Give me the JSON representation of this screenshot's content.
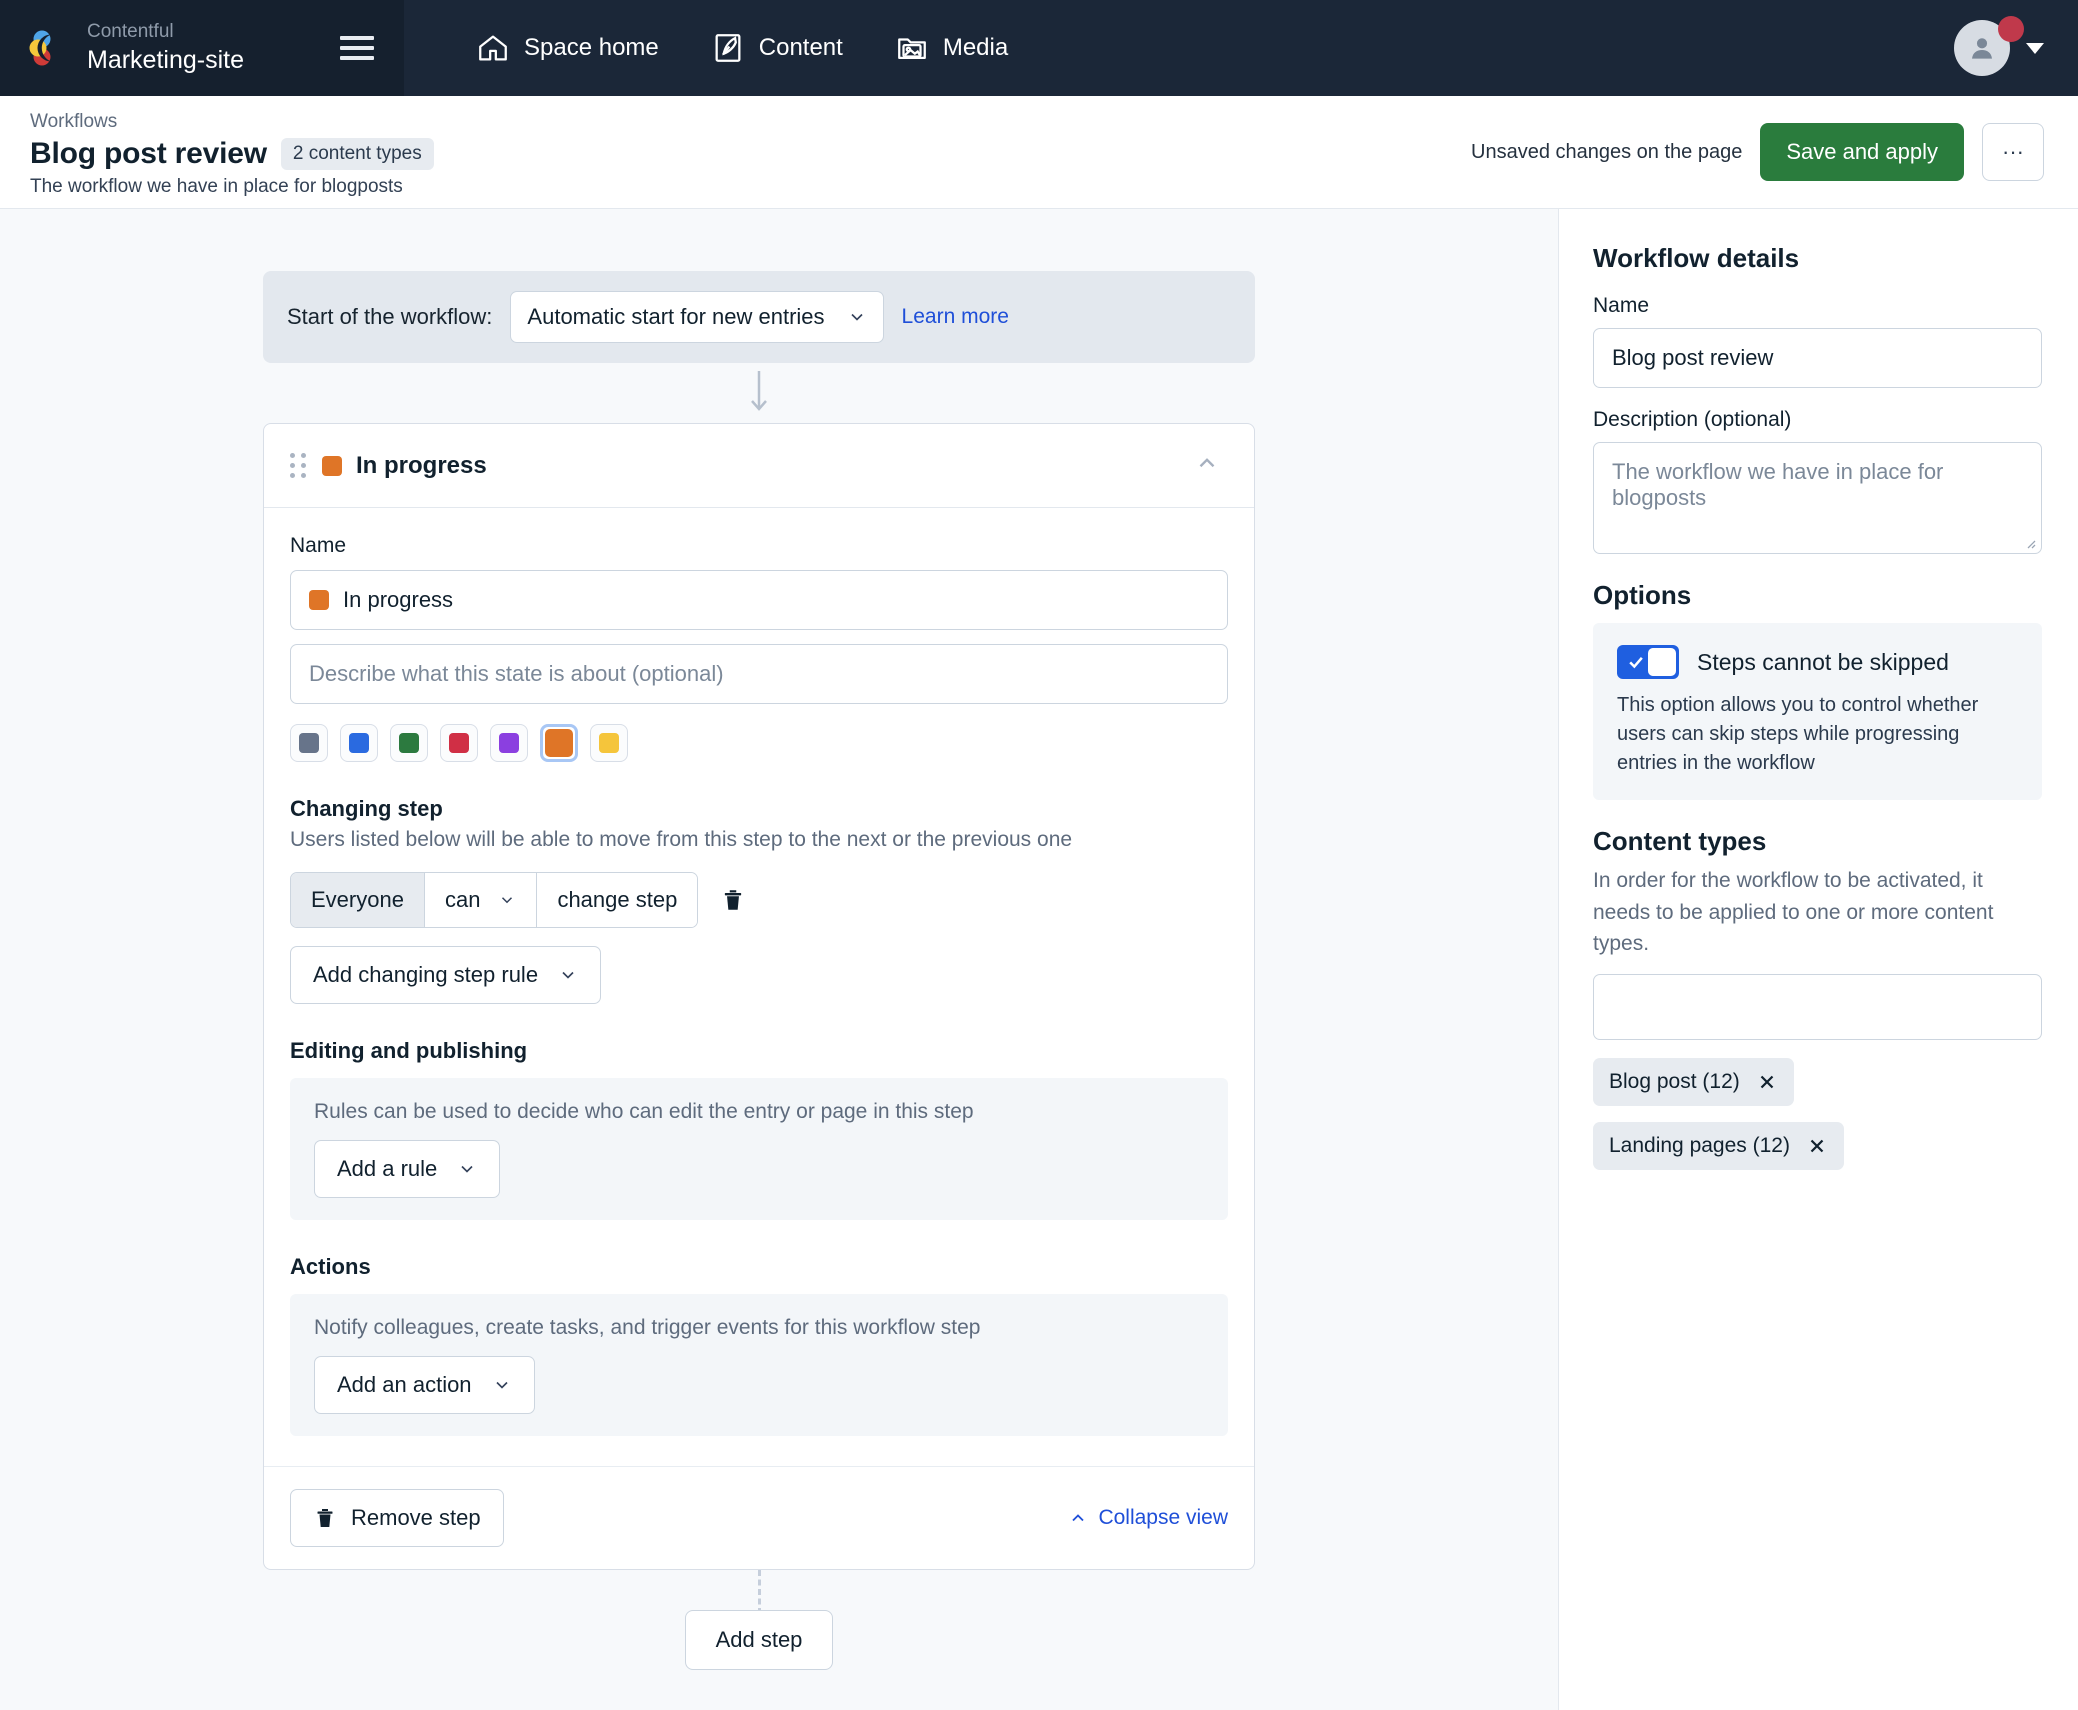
{
  "topnav": {
    "org_name": "Contentful",
    "space_name": "Marketing-site",
    "menu_icon": "hamburger-icon",
    "items": [
      {
        "label": "Space home",
        "icon": "home-icon"
      },
      {
        "label": "Content",
        "icon": "content-pen-icon"
      },
      {
        "label": "Media",
        "icon": "media-image-icon"
      }
    ],
    "avatar_icon": "user-avatar-icon",
    "has_notification": true
  },
  "header": {
    "breadcrumb": "Workflows",
    "title": "Blog post review",
    "badge": "2 content types",
    "subtitle": "The workflow we have in place for blogposts",
    "unsaved_text": "Unsaved changes on the page",
    "save_label": "Save and apply",
    "more_label": "···"
  },
  "start_bar": {
    "label": "Start of the workflow:",
    "selected": "Automatic start for new entries",
    "learn_more": "Learn more"
  },
  "step": {
    "title": "In progress",
    "color": "#df7527",
    "name_label": "Name",
    "name_value": "In progress",
    "desc_placeholder": "Describe what this state is about (optional)",
    "colors": [
      {
        "name": "gray",
        "hex": "#67748a",
        "selected": false
      },
      {
        "name": "blue",
        "hex": "#2a6ae0",
        "selected": false
      },
      {
        "name": "green",
        "hex": "#2c7a3f",
        "selected": false
      },
      {
        "name": "red",
        "hex": "#d02f45",
        "selected": false
      },
      {
        "name": "purple",
        "hex": "#8b3fe0",
        "selected": false
      },
      {
        "name": "orange",
        "hex": "#df7527",
        "selected": true
      },
      {
        "name": "yellow",
        "hex": "#f5c council",
        "selected": false
      }
    ],
    "changing_step": {
      "title": "Changing step",
      "desc": "Users listed below will be able to move from this step to the next or the previous one",
      "rule": {
        "who": "Everyone",
        "verb": "can",
        "action": "change step"
      },
      "add_rule_label": "Add changing step rule"
    },
    "editing": {
      "title": "Editing and publishing",
      "desc": "Rules can be used to decide who can edit the entry or page in this step",
      "add_label": "Add a rule"
    },
    "actions": {
      "title": "Actions",
      "desc": "Notify colleagues, create tasks, and trigger events for this workflow step",
      "add_label": "Add an action"
    },
    "remove_label": "Remove step",
    "collapse_label": "Collapse view"
  },
  "add_step_label": "Add step",
  "sidebar": {
    "title": "Workflow details",
    "name_label": "Name",
    "name_value": "Blog post review",
    "desc_label": "Description (optional)",
    "desc_placeholder": "The workflow we have in place for blogposts",
    "options_title": "Options",
    "option": {
      "label": "Steps cannot be skipped",
      "enabled": true,
      "desc": "This option allows you to control whether users can skip steps while progressing entries in the workflow"
    },
    "content_types_title": "Content types",
    "content_types_desc": "In order for the workflow to be activated, it needs to be applied to one or more content types.",
    "content_types_input_value": "",
    "tags": [
      {
        "label": "Blog post (12)"
      },
      {
        "label": "Landing pages (12)"
      }
    ]
  }
}
